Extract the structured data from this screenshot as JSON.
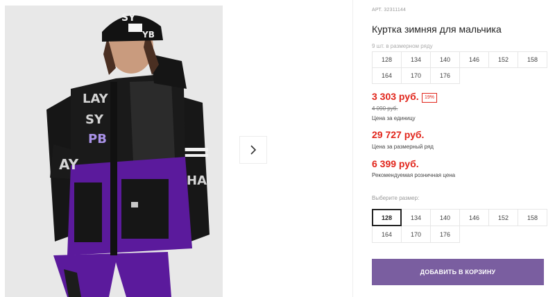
{
  "gallery": {
    "next_icon": "chevron-right-icon"
  },
  "product": {
    "article": "АРТ. 32311144",
    "title": "Куртка зимняя для мальчика",
    "size_row_note": "9 шт. в размерном ряду",
    "size_row": [
      "128",
      "134",
      "140",
      "146",
      "152",
      "158",
      "164",
      "170",
      "176"
    ],
    "price": "3 303 руб.",
    "discount": "19%",
    "old_price": "4 090 руб.",
    "price_unit_label": "Цена за единицу",
    "row_price": "29 727 руб.",
    "row_price_label": "Цена за размерный ряд",
    "rrp": "6 399 руб.",
    "rrp_label": "Рекомендуемая розничная цена",
    "choose_size_label": "Выберите размер:",
    "sizes": [
      "128",
      "134",
      "140",
      "146",
      "152",
      "158",
      "164",
      "170",
      "176"
    ],
    "selected_size": "128",
    "add_to_cart": "ДОБАВИТЬ В КОРЗИНУ"
  },
  "colors": {
    "accent": "#7a5ea0",
    "price": "#e1251b",
    "jacket_purple": "#5b1a9c"
  }
}
